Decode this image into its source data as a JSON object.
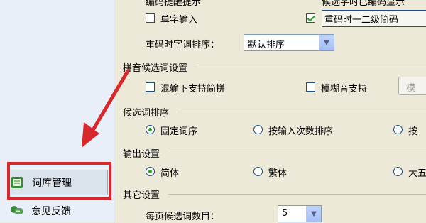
{
  "sidebar": {
    "items": [
      {
        "label": "词库管理",
        "icon": "dictionary-icon"
      },
      {
        "label": "意见反馈",
        "icon": "feedback-icon"
      }
    ],
    "highlight_color": "#d8282b"
  },
  "top": {
    "cut_label_1": "编码提醒提示",
    "cut_label_2": "候选字时已编码显示",
    "single_char_input": "单字输入",
    "duplicate_code_label": "重码时一二级简码"
  },
  "sort_row": {
    "label": "重码时字词排序：",
    "value": "默认排序"
  },
  "pinyin_section": {
    "title": "拼音候选词设置",
    "mixed_simple_pinyin": "混输下支持简拼",
    "fuzzy_pinyin": "模糊音支持",
    "fuzzy_button": "模"
  },
  "candidate_sort": {
    "title": "候选词排序",
    "options": [
      "固定词序",
      "按输入次数排序",
      "按"
    ]
  },
  "output": {
    "title": "输出设置",
    "options": [
      "简体",
      "繁体",
      "大五"
    ]
  },
  "other": {
    "title": "其它设置",
    "per_page_label": "每页候选词数目：",
    "per_page_value": "5"
  }
}
